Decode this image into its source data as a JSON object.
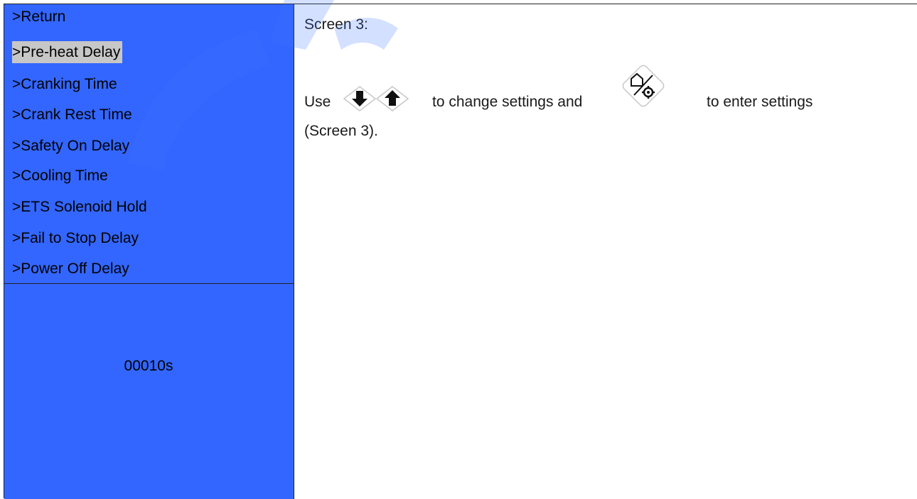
{
  "menu": {
    "items": [
      ">Return",
      ">Pre-heat Delay",
      ">Cranking Time",
      ">Crank Rest Time",
      ">Safety On Delay",
      ">Cooling Time",
      ">ETS Solenoid Hold",
      ">Fail to Stop Delay",
      ">Power Off Delay"
    ],
    "selected_index": 1
  },
  "value_display": "00010s",
  "instructions": {
    "screen_label": "Screen 3:",
    "use": "Use",
    "change_text": "to change settings and",
    "enter_text": "to enter settings",
    "reference": "(Screen 3)."
  },
  "icons": [
    "down-arrow-key-icon",
    "up-arrow-key-icon",
    "home-settings-key-icon"
  ],
  "colors": {
    "lcd_background": "#3366ff",
    "selected_row": "#c7c7c7",
    "watermark": "#3a72ff"
  }
}
